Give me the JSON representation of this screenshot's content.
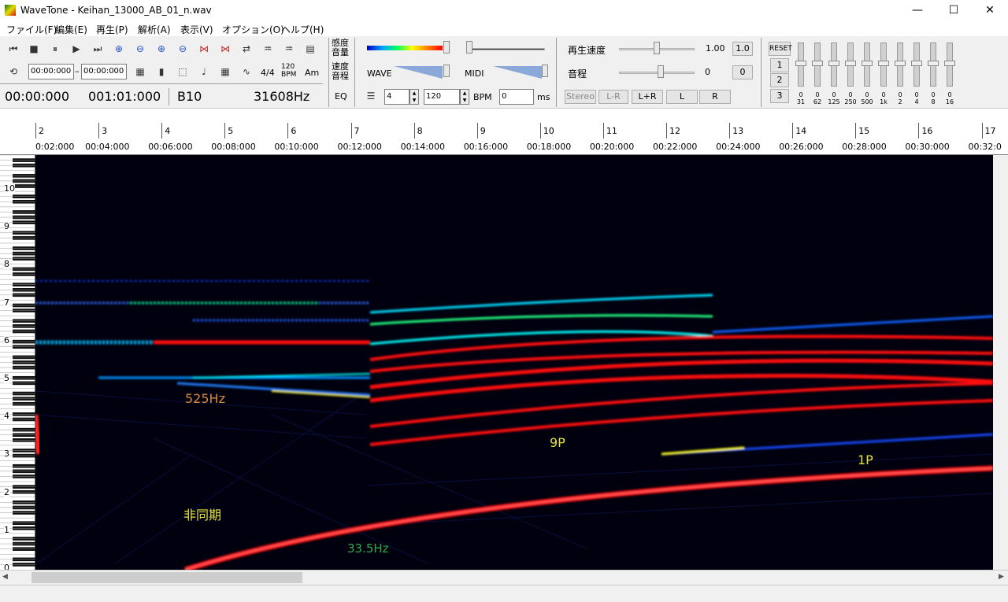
{
  "window": {
    "title": "WaveTone - Keihan_13000_AB_01_n.wav",
    "minimize": "—",
    "maximize": "☐",
    "close": "✕"
  },
  "menu": [
    "ファイル(F)",
    "編集(E)",
    "再生(P)",
    "解析(A)",
    "表示(V)",
    "オプション(O)",
    "ヘルプ(H)"
  ],
  "transport": {
    "start_time": "00:00:000",
    "end_time": "00:00:000",
    "range_sep": "–",
    "sig": "4/4",
    "bpm_top": "120",
    "bpm_bottom": "BPM",
    "am": "Am"
  },
  "status": {
    "time": "00:00:000",
    "measure": "001:01:000",
    "note": "B10",
    "freq": "31608Hz"
  },
  "settings": {
    "sensitivity": "感度",
    "volume": "音量",
    "speed": "速度",
    "pitch_label": "音程",
    "eq": "EQ",
    "wave": "WAVE",
    "midi": "MIDI",
    "grid_value": "4",
    "bpm_value": "120",
    "bpm_label": "BPM",
    "ms_value": "0",
    "ms_label": "ms"
  },
  "playback": {
    "speed_label": "再生速度",
    "speed_value": "1.00",
    "speed_reset": "1.0",
    "pitch_label": "音程",
    "pitch_value": "0",
    "pitch_reset": "0",
    "stereo": "Stereo",
    "lr_minus": "L-R",
    "lr_plus": "L+R",
    "left": "L",
    "right": "R"
  },
  "eq": {
    "reset": "RESET",
    "presets": [
      "1",
      "2",
      "3"
    ],
    "bands": [
      {
        "value": "0",
        "freq": "31"
      },
      {
        "value": "0",
        "freq": "62"
      },
      {
        "value": "0",
        "freq": "125"
      },
      {
        "value": "0",
        "freq": "250"
      },
      {
        "value": "0",
        "freq": "500"
      },
      {
        "value": "0",
        "freq": "1k"
      },
      {
        "value": "0",
        "freq": "2"
      },
      {
        "value": "0",
        "freq": "4"
      },
      {
        "value": "0",
        "freq": "8"
      },
      {
        "value": "0",
        "freq": "16"
      }
    ]
  },
  "ruler": {
    "measures": [
      "2",
      "3",
      "4",
      "5",
      "6",
      "7",
      "8",
      "9",
      "10",
      "11",
      "12",
      "13",
      "14",
      "15",
      "16",
      "17"
    ],
    "times": [
      "0:02:000",
      "00:04:000",
      "00:06:000",
      "00:08:000",
      "00:10:000",
      "00:12:000",
      "00:14:000",
      "00:16:000",
      "00:18:000",
      "00:20:000",
      "00:22:000",
      "00:24:000",
      "00:26:000",
      "00:28:000",
      "00:30:000",
      "00:32:0"
    ]
  },
  "octaves": [
    "10",
    "9",
    "8",
    "7",
    "6",
    "5",
    "4",
    "3",
    "2",
    "1",
    "0"
  ],
  "annotations": {
    "hz525": "525Hz",
    "nonsync": "非同期",
    "hz33": "33.5Hz",
    "p9": "9P",
    "p1": "1P"
  },
  "colors": {
    "annot_orange": "#d88a3c",
    "annot_yellow": "#e6e23c",
    "annot_green": "#2ea84a"
  }
}
